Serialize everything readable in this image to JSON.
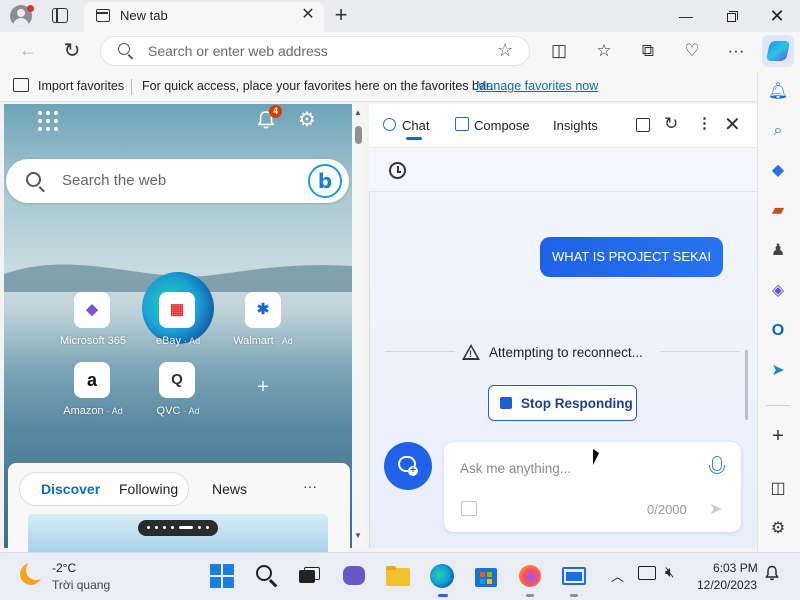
{
  "browser": {
    "tab_title": "New tab",
    "address_placeholder": "Search or enter web address",
    "favorites_bar": {
      "import_label": "Import favorites",
      "message": "For quick access, place your favorites here on the favorites bar.",
      "manage_link": "Manage favorites now"
    }
  },
  "new_tab_page": {
    "notification_count": "4",
    "search_placeholder": "Search the web",
    "sites": [
      {
        "name": "Microsoft 365",
        "ad": ""
      },
      {
        "name": "eBay",
        "ad": "· Ad"
      },
      {
        "name": "Walmart",
        "ad": "· Ad"
      },
      {
        "name": "Amazon",
        "ad": "· Ad"
      },
      {
        "name": "QVC",
        "ad": "· Ad"
      }
    ],
    "feed_tabs": [
      "Discover",
      "Following",
      "News"
    ],
    "feed_more": "···"
  },
  "copilot": {
    "tabs": [
      "Chat",
      "Compose",
      "Insights"
    ],
    "active_tab": "Chat",
    "user_message": "WHAT IS PROJECT SEKAI",
    "status_text": "Attempting to reconnect...",
    "stop_button": "Stop Responding",
    "input_placeholder": "Ask me anything...",
    "char_count": "0/2000"
  },
  "taskbar": {
    "weather_temp": "-2°C",
    "weather_desc": "Trời quang",
    "time": "6:03 PM",
    "date": "12/20/2023"
  },
  "colors": {
    "accent": "#1f62e8",
    "link": "#0f6cbd",
    "badge": "#d83b01"
  }
}
